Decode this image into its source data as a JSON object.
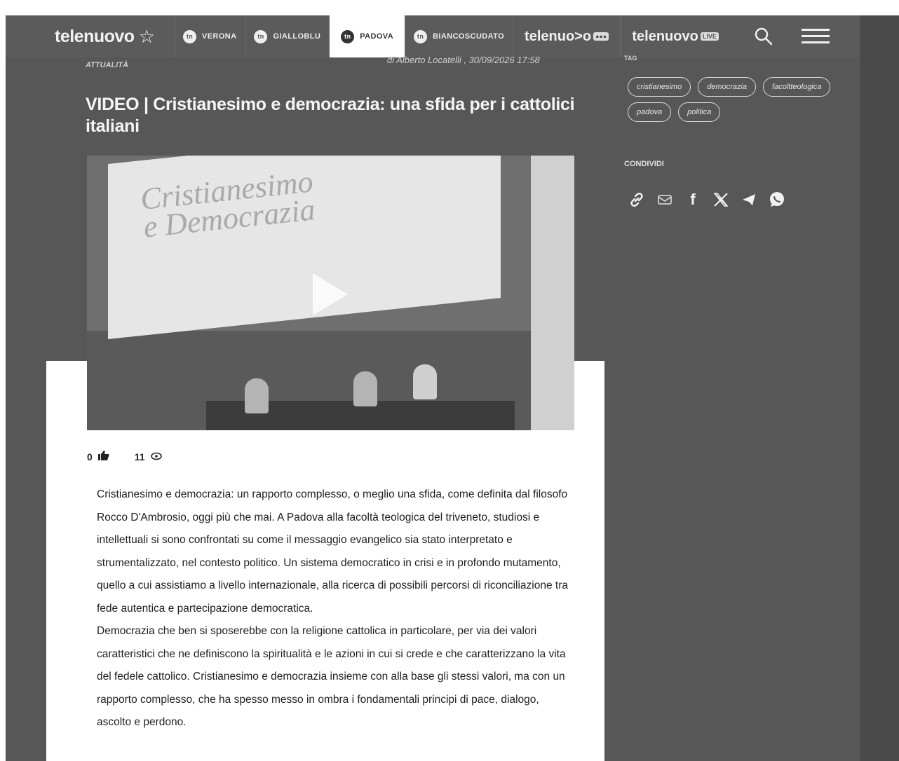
{
  "nav": {
    "brand": "telenuovo",
    "items": [
      {
        "badge": "tn",
        "label": "VERONA",
        "active": false
      },
      {
        "badge": "tn",
        "label": "GIALLOBLU",
        "active": false
      },
      {
        "badge": "tn",
        "label": "PADOVA",
        "active": true
      },
      {
        "badge": "tn",
        "label": "BIANCOSCUDATO",
        "active": false
      }
    ],
    "brand_links": [
      {
        "label": "telenuo>o",
        "suffix": "●●●"
      },
      {
        "label": "telenuovo",
        "suffix": "LIVE"
      }
    ],
    "icons": [
      "search-icon",
      "menu-icon"
    ]
  },
  "article": {
    "category": "ATTUALITÀ",
    "byline": "di Alberto Locatelli , 30/09/2026 17:58",
    "title": "VIDEO | Cristianesimo e democrazia: una sfida per i cattolici italiani",
    "video": {
      "screen_text": [
        "Cristianesimo",
        "e Democrazia"
      ]
    },
    "likes": "0",
    "views": "11",
    "paragraphs": [
      "Cristianesimo e democrazia: un rapporto complesso, o meglio una sfida, come definita dal filosofo Rocco D'Ambrosio, oggi più che mai. A Padova alla facoltà teologica del triveneto, studiosi e intellettuali si sono confrontati su come il messaggio evangelico sia stato interpretato e strumentalizzato, nel contesto politico. Un sistema democratico in crisi e in profondo mutamento, quello a cui assistiamo a livello internazionale, alla ricerca di possibili percorsi di riconciliazione tra fede autentica e partecipazione democratica.",
      "Democrazia che ben si sposerebbe con la religione cattolica in particolare, per via dei valori caratteristici che ne definiscono la spiritualità e le azioni in cui si crede e che caratterizzano la vita del fedele cattolico. Cristianesimo e democrazia insieme con alla base gli stessi valori, ma con un rapporto complesso, che ha spesso messo in ombra i fondamentali principi di pace, dialogo, ascolto e perdono."
    ]
  },
  "sidebar": {
    "tag_heading": "TAG",
    "tags": [
      "cristianesimo",
      "democrazia",
      "facoltteologica",
      "padova",
      "politica"
    ],
    "share_heading": "CONDIVIDI",
    "share_icons": [
      "link-icon",
      "mail-icon",
      "facebook-icon",
      "x-icon",
      "telegram-icon",
      "whatsapp-icon"
    ]
  }
}
